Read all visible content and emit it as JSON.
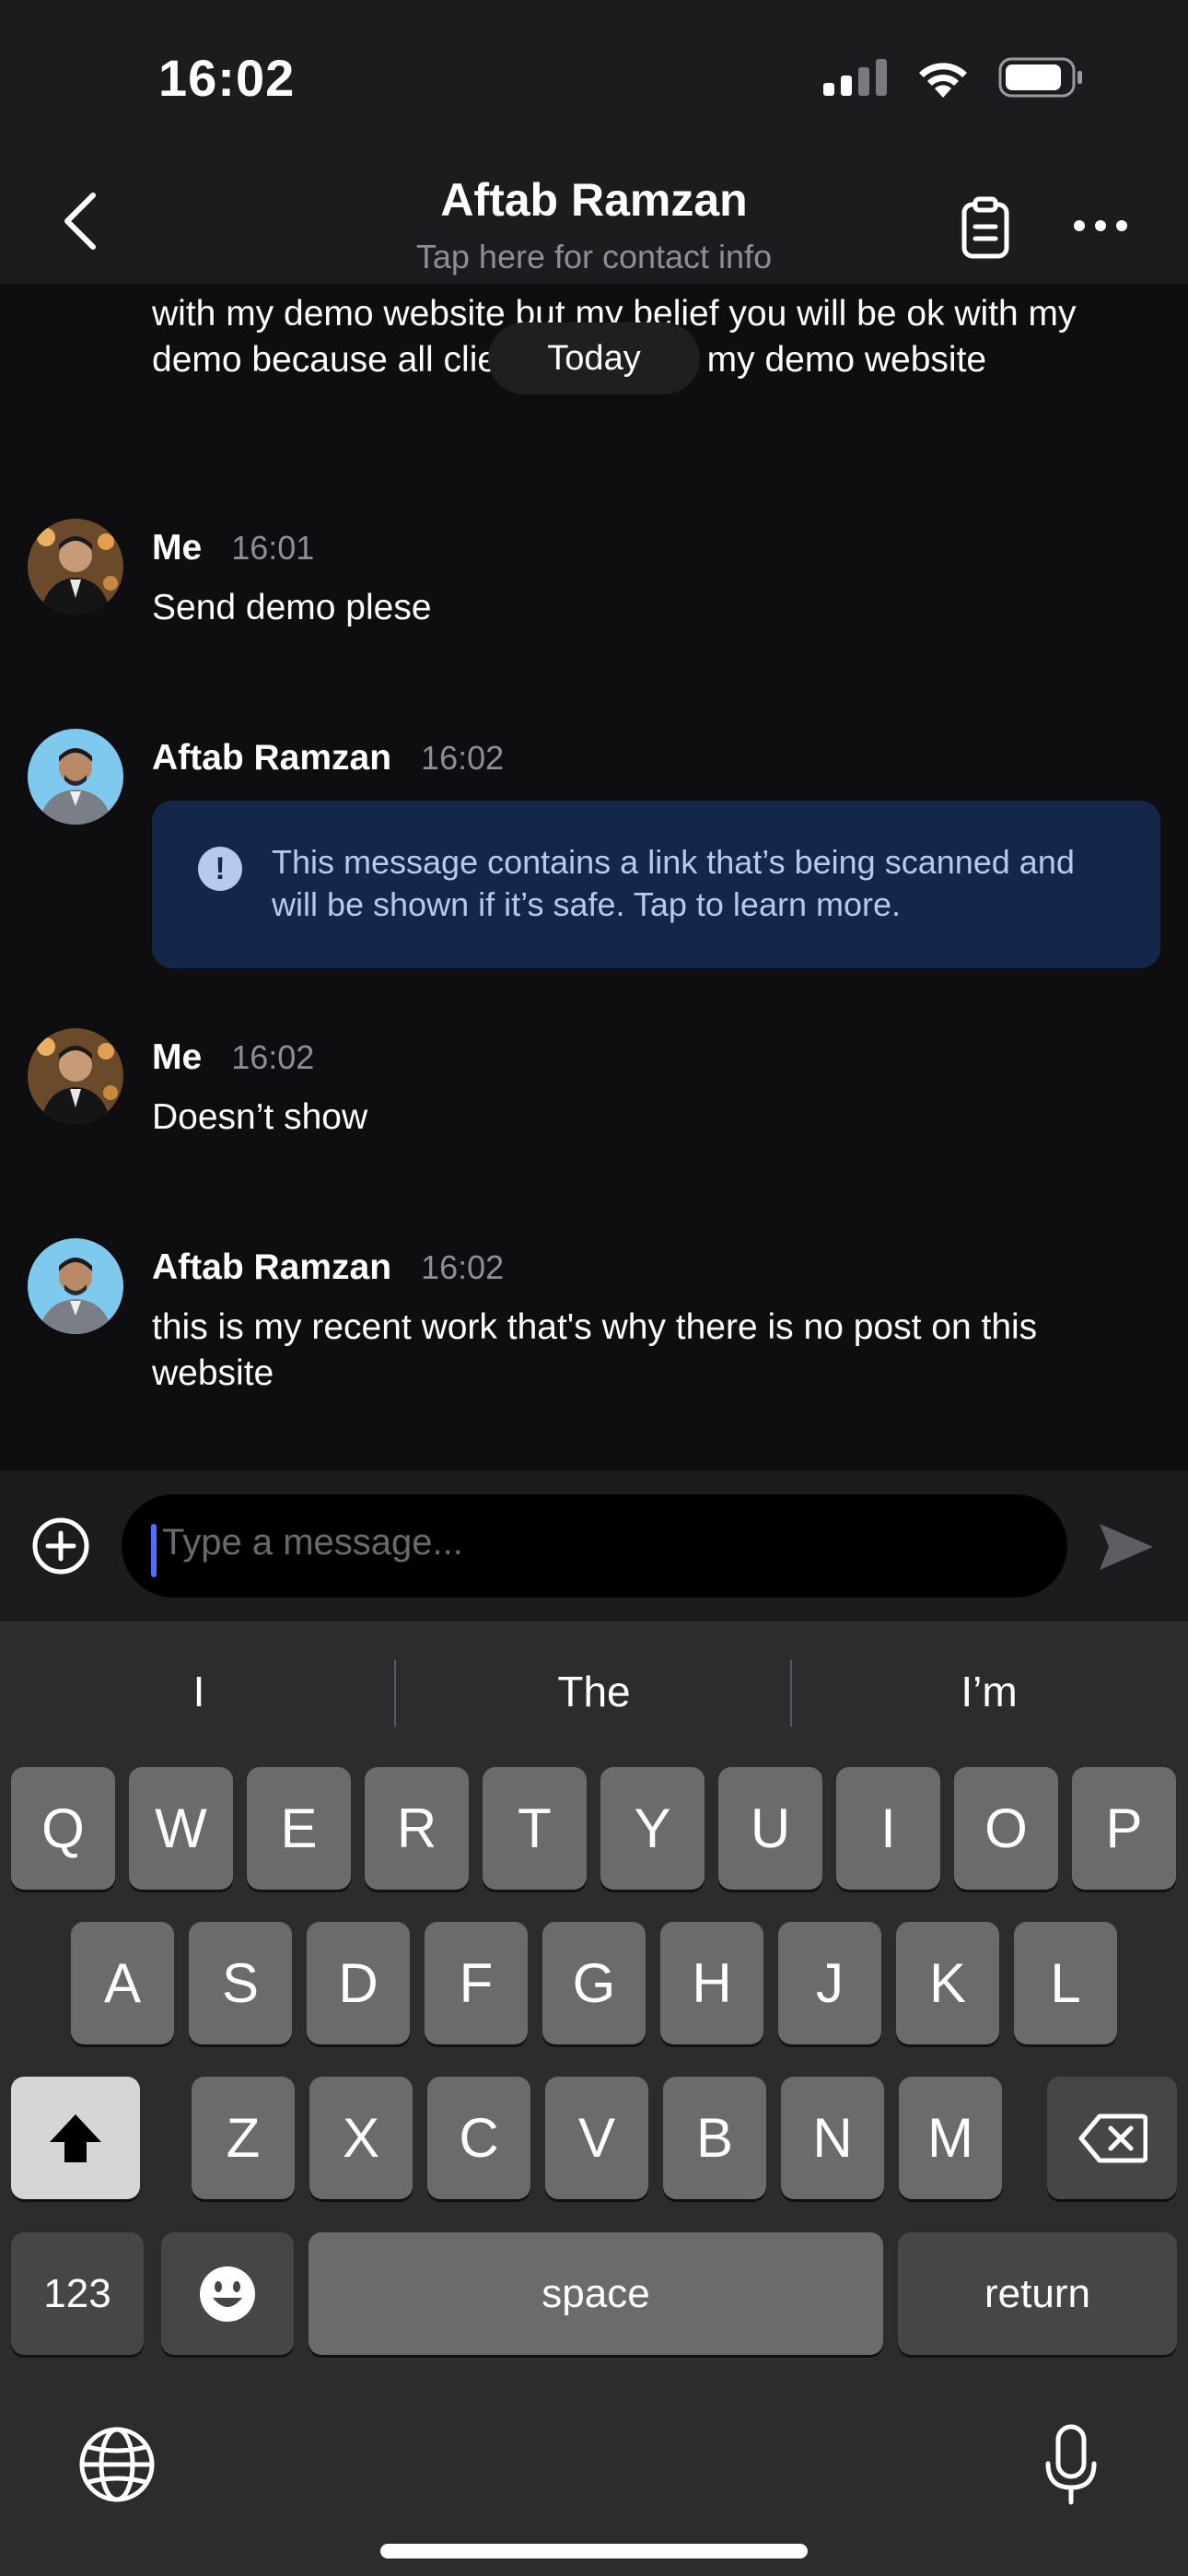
{
  "status_bar": {
    "time": "16:02"
  },
  "header": {
    "title": "Aftab Ramzan",
    "subtitle": "Tap here for contact info"
  },
  "conversation": {
    "partial_message": "with my demo website but my belief you will be ok with my demo because all clients have like my demo website",
    "date_pill": "Today",
    "messages": [
      {
        "sender": "Me",
        "time": "16:01",
        "text": "Send demo plese"
      },
      {
        "sender": "Aftab Ramzan",
        "time": "16:02",
        "notice": "This message contains a link that’s being scanned and will be shown if it’s safe. Tap to learn more."
      },
      {
        "sender": "Me",
        "time": "16:02",
        "text": "Doesn’t show"
      },
      {
        "sender": "Aftab Ramzan",
        "time": "16:02",
        "text": "this is my recent work that's why there is no post on this website"
      }
    ]
  },
  "composer": {
    "placeholder": "Type a message..."
  },
  "keyboard": {
    "suggestions": [
      "I",
      "The",
      "I’m"
    ],
    "row1": [
      "Q",
      "W",
      "E",
      "R",
      "T",
      "Y",
      "U",
      "I",
      "O",
      "P"
    ],
    "row2": [
      "A",
      "S",
      "D",
      "F",
      "G",
      "H",
      "J",
      "K",
      "L"
    ],
    "row3": [
      "Z",
      "X",
      "C",
      "V",
      "B",
      "N",
      "M"
    ],
    "numbers_label": "123",
    "space_label": "space",
    "return_label": "return"
  },
  "colors": {
    "background": "#0e0e10",
    "bar": "#1c1c1e",
    "notice_bg": "#14264a",
    "notice_text": "#b8c8ef",
    "caret": "#4f6fff"
  }
}
